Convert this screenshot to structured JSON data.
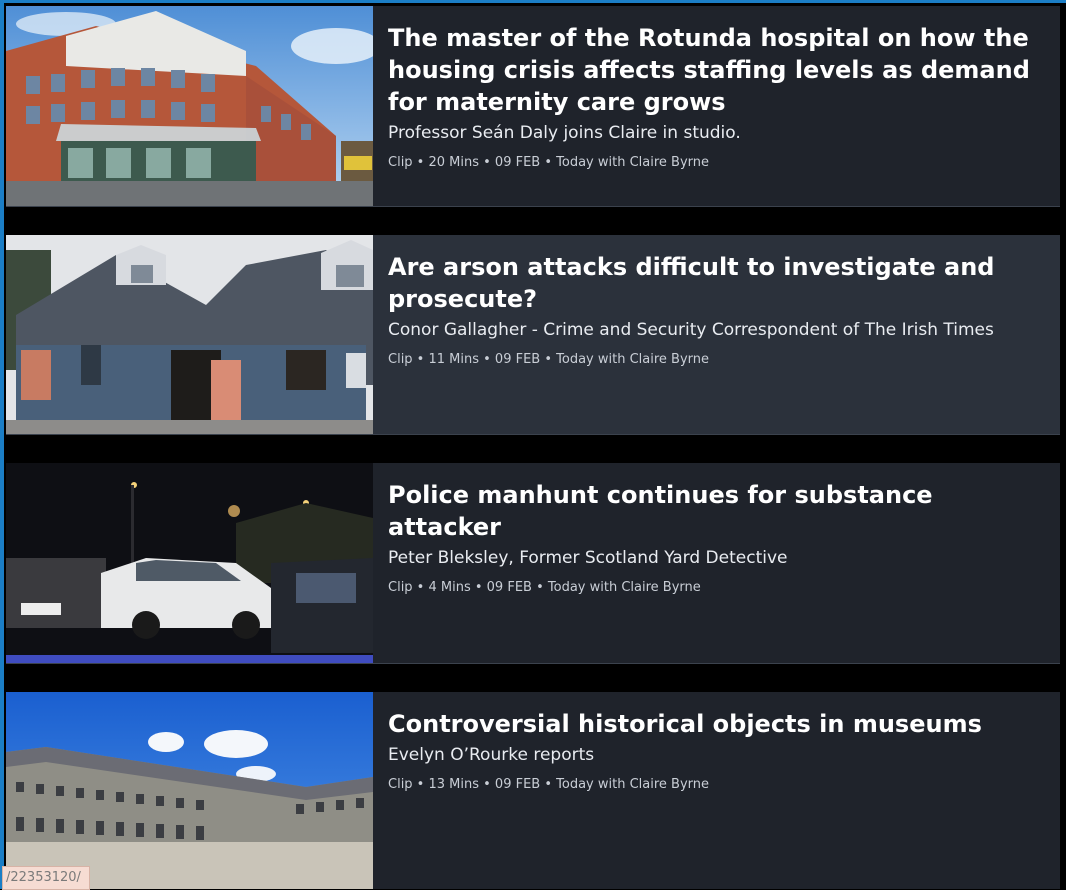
{
  "clips": [
    {
      "title": "The master of the Rotunda hospital on how the housing crisis affects staffing levels as demand for maternity care grows",
      "subtitle": "Professor Seán Daly joins Claire in studio.",
      "meta": "Clip • 20 Mins • 09 FEB • Today with Claire Byrne",
      "thumbnail_icon": "hospital-building-photo"
    },
    {
      "title": "Are arson attacks difficult to investigate and prosecute?",
      "subtitle": "Conor Gallagher - Crime and Security Correspondent of The Irish Times",
      "meta": "Clip • 11 Mins • 09 FEB • Today with Claire Byrne",
      "thumbnail_icon": "burnt-house-photo"
    },
    {
      "title": "Police manhunt continues for substance attacker",
      "subtitle": "Peter Bleksley, Former Scotland Yard Detective",
      "meta": "Clip • 4 Mins • 09 FEB • Today with Claire Byrne",
      "thumbnail_icon": "night-street-cars-photo"
    },
    {
      "title": "Controversial historical objects in museums",
      "subtitle": "Evelyn O’Rourke reports",
      "meta": "Clip • 13 Mins • 09 FEB • Today with Claire Byrne",
      "thumbnail_icon": "museum-courtyard-photo"
    }
  ],
  "status_url": "/22353120/",
  "colors": {
    "card_bg": "#1f232b",
    "card_hover_bg": "#2b313b",
    "page_bg": "#000000",
    "accent_edge": "#1b7ec6"
  }
}
